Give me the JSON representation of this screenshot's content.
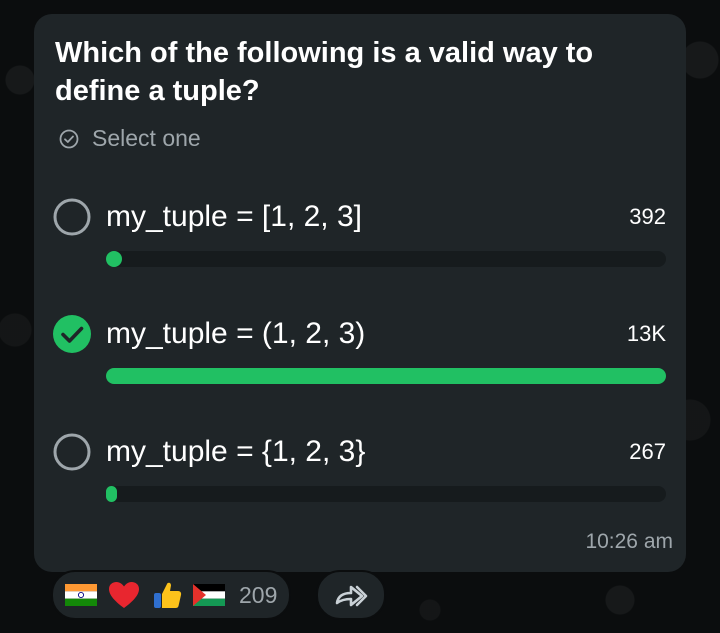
{
  "poll": {
    "question": "Which of the following is a valid way to define a tuple?",
    "select_hint": "Select one",
    "options": [
      {
        "label": "my_tuple = [1, 2, 3]",
        "count": "392",
        "fraction": 0.0289,
        "selected": false
      },
      {
        "label": "my_tuple = (1, 2, 3)",
        "count": "13K",
        "fraction": 1.0,
        "selected": true
      },
      {
        "label": "my_tuple = {1, 2, 3}",
        "count": "267",
        "fraction": 0.0197,
        "selected": false
      }
    ],
    "timestamp": "10:26 am"
  },
  "reactions": {
    "emojis": [
      "india-flag-icon",
      "red-heart-icon",
      "thumbs-up-icon",
      "palestine-flag-icon"
    ],
    "count": "209"
  },
  "colors": {
    "accent": "#21c063",
    "bubble": "#1f2528",
    "background": "#0b0d0e",
    "track": "#161b1d",
    "muted_text": "#9ea6ab"
  }
}
